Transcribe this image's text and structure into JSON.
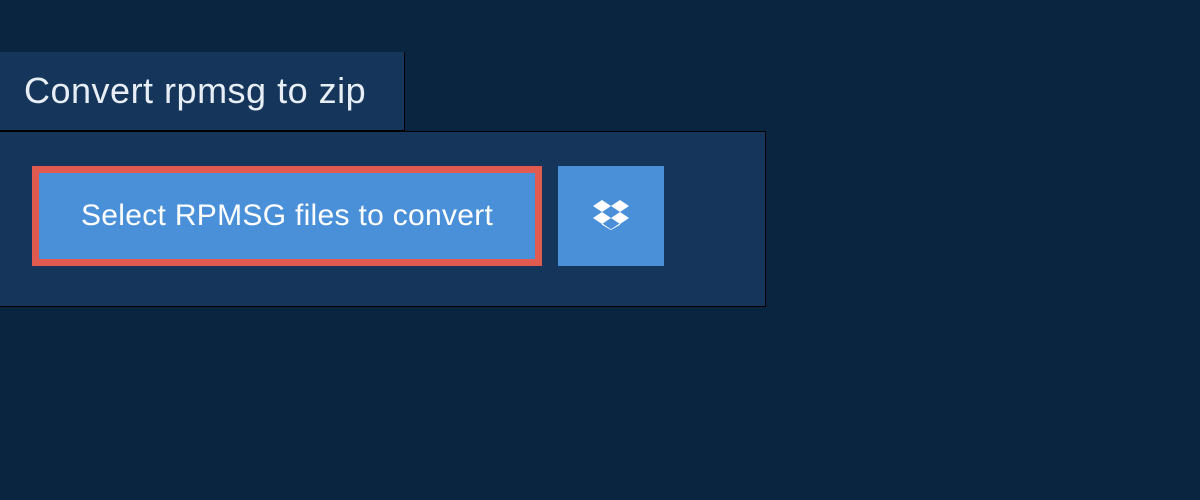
{
  "header": {
    "title": "Convert rpmsg to zip"
  },
  "actions": {
    "select_label": "Select RPMSG files to convert",
    "dropbox_icon": "dropbox-icon"
  },
  "colors": {
    "bg": "#0a2540",
    "panel": "#15365a",
    "button": "#4a90d9",
    "highlight_border": "#e05a4f",
    "text": "#e8eef5"
  }
}
